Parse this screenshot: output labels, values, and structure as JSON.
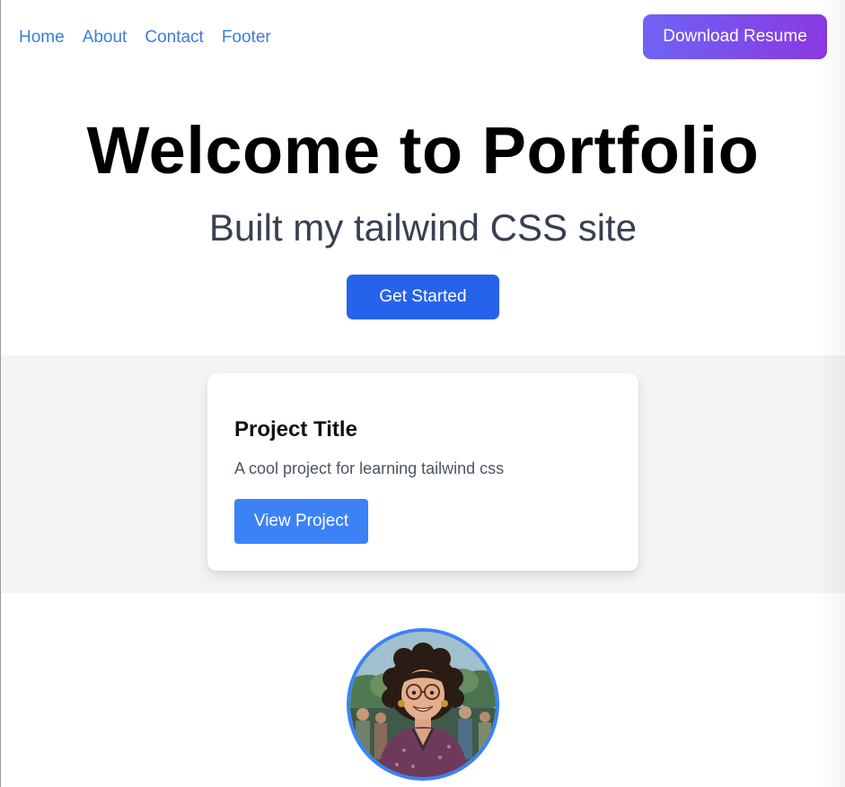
{
  "nav": {
    "links": [
      "Home",
      "About",
      "Contact",
      "Footer"
    ],
    "download_label": "Download Resume"
  },
  "hero": {
    "title": "Welcome to Portfolio",
    "subtitle": "Built my tailwind CSS site",
    "cta_label": "Get Started"
  },
  "project": {
    "title": "Project Title",
    "description": "A cool project for learning tailwind css",
    "button_label": "View Project"
  },
  "profile": {
    "avatar_icon": "profile-photo"
  },
  "colors": {
    "nav_link": "#3b7ddd",
    "download_gradient_start": "#6f63f4",
    "download_gradient_end": "#8a38e3",
    "get_started": "#2563eb",
    "view_project": "#3b82f6",
    "band_background": "#f3f4f6",
    "avatar_border": "#3b82f6"
  }
}
